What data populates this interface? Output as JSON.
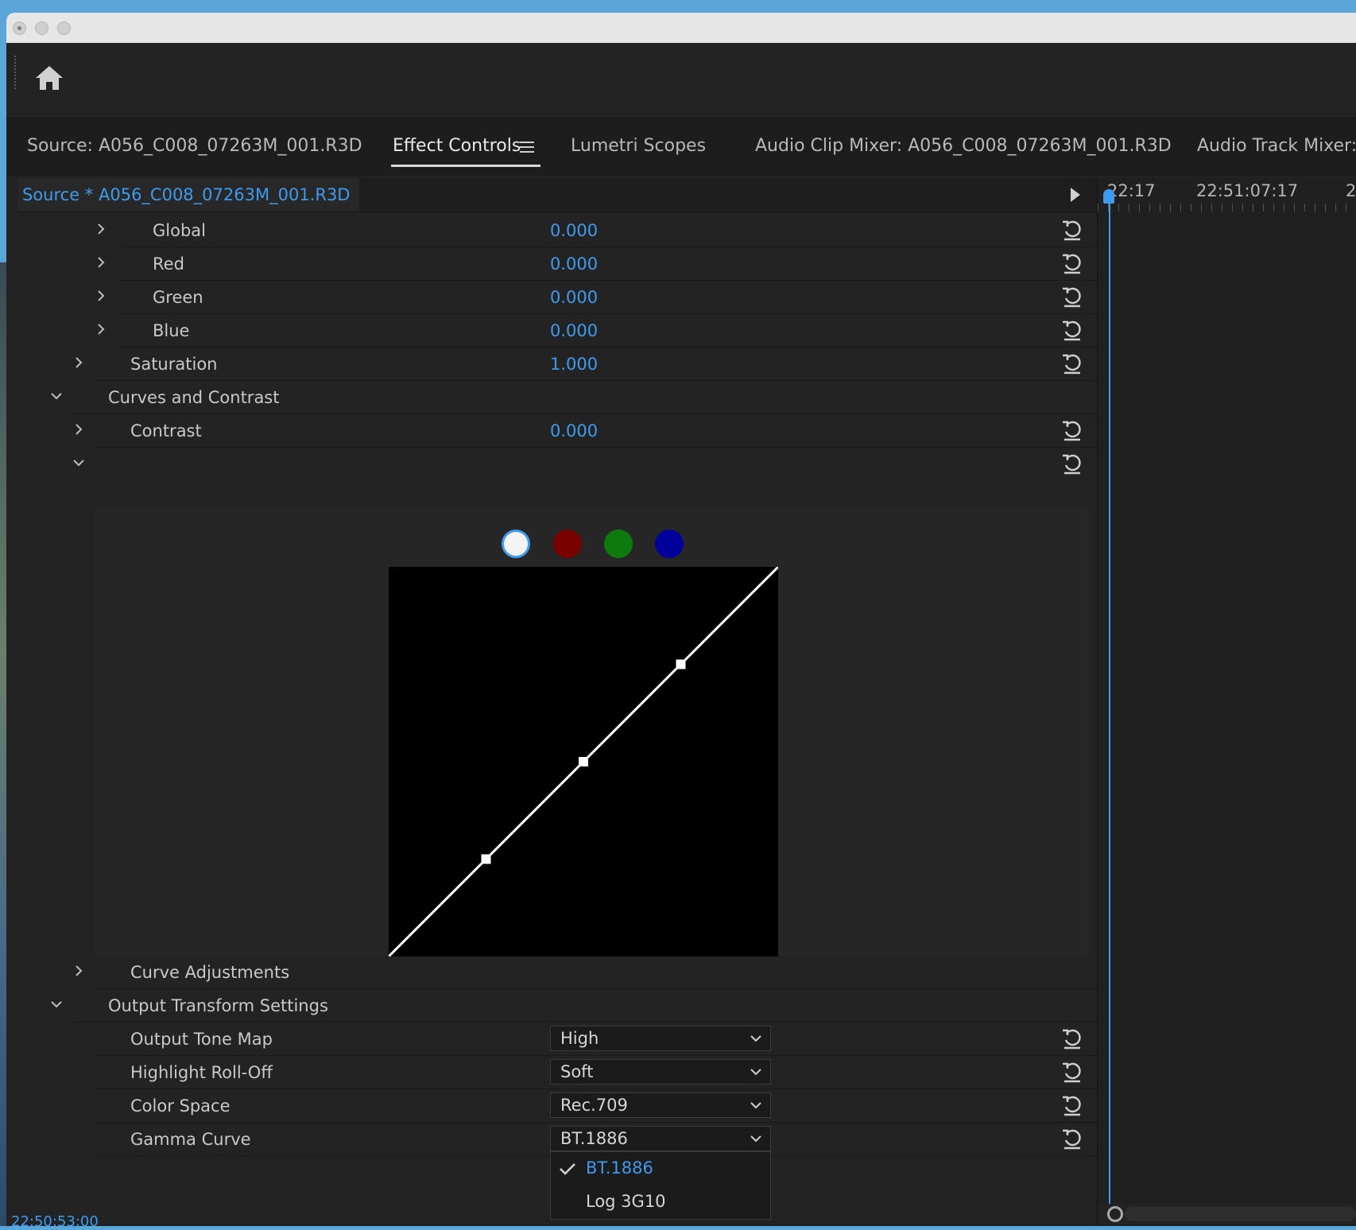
{
  "colors": {
    "accent": "#3d9bf0",
    "panel_bg": "#232323",
    "text": "#c9c9c9"
  },
  "tabs": [
    {
      "label": "Source: A056_C008_07263M_001.R3D"
    },
    {
      "label": "Effect Controls"
    },
    {
      "label": "Lumetri Scopes"
    },
    {
      "label": "Audio Clip Mixer: A056_C008_07263M_001.R3D"
    },
    {
      "label": "Audio Track Mixer: ("
    }
  ],
  "source_bar": {
    "title": "Source * A056_C008_07263M_001.R3D"
  },
  "timeline": {
    "timecode_1": "22:17",
    "timecode_2": "22:51:07:17",
    "timecode_3": "2"
  },
  "params": {
    "global": {
      "label": "Global",
      "value": "0.000"
    },
    "red": {
      "label": "Red",
      "value": "0.000"
    },
    "green": {
      "label": "Green",
      "value": "0.000"
    },
    "blue": {
      "label": "Blue",
      "value": "0.000"
    },
    "saturation": {
      "label": "Saturation",
      "value": "1.000"
    },
    "curves_section": {
      "label": "Curves and Contrast"
    },
    "contrast": {
      "label": "Contrast",
      "value": "0.000"
    },
    "curve_adjustments": {
      "label": "Curve Adjustments"
    },
    "output_section": {
      "label": "Output Transform Settings"
    }
  },
  "curve_channels": [
    "white",
    "red",
    "green",
    "blue"
  ],
  "curve_points": [
    [
      0,
      0
    ],
    [
      0.25,
      0.25
    ],
    [
      0.5,
      0.5
    ],
    [
      0.75,
      0.75
    ],
    [
      1,
      1
    ]
  ],
  "output": {
    "tone_map": {
      "label": "Output Tone Map",
      "value": "High"
    },
    "rolloff": {
      "label": "Highlight Roll-Off",
      "value": "Soft"
    },
    "color_space": {
      "label": "Color Space",
      "value": "Rec.709"
    },
    "gamma": {
      "label": "Gamma Curve",
      "value": "BT.1886"
    }
  },
  "gamma_menu": {
    "selected": "BT.1886",
    "other": "Log 3G10"
  },
  "status_timecode": "22:50:53:00"
}
